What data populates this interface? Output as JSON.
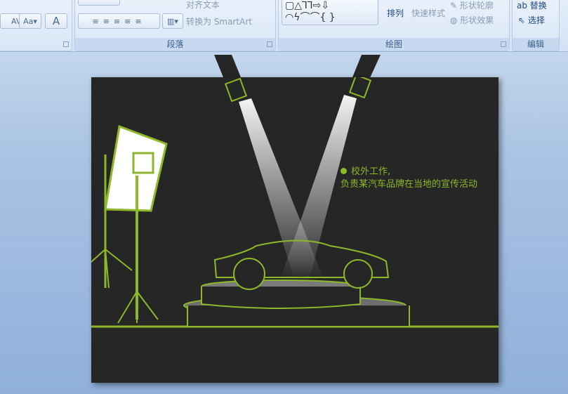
{
  "ribbon": {
    "font_group": {
      "spacing": "AV",
      "case": "Aa",
      "color": "A"
    },
    "paragraph": {
      "label": "段落",
      "align_text": "对齐文本",
      "smartart": "转换为 SmartArt"
    },
    "drawing": {
      "label": "绘图",
      "arrange": "排列",
      "quick_styles": "快速样式",
      "shape_outline": "形状轮廓",
      "shape_effects": "形状效果"
    },
    "editing": {
      "label": "编辑",
      "replace": "替换",
      "select": "选择"
    }
  },
  "slide": {
    "bullet_line1": "校外工作,",
    "bullet_line2": "负责某汽车品牌在当地的宣传活动"
  },
  "colors": {
    "accent": "#8cb82a",
    "slide_bg": "#262626"
  }
}
